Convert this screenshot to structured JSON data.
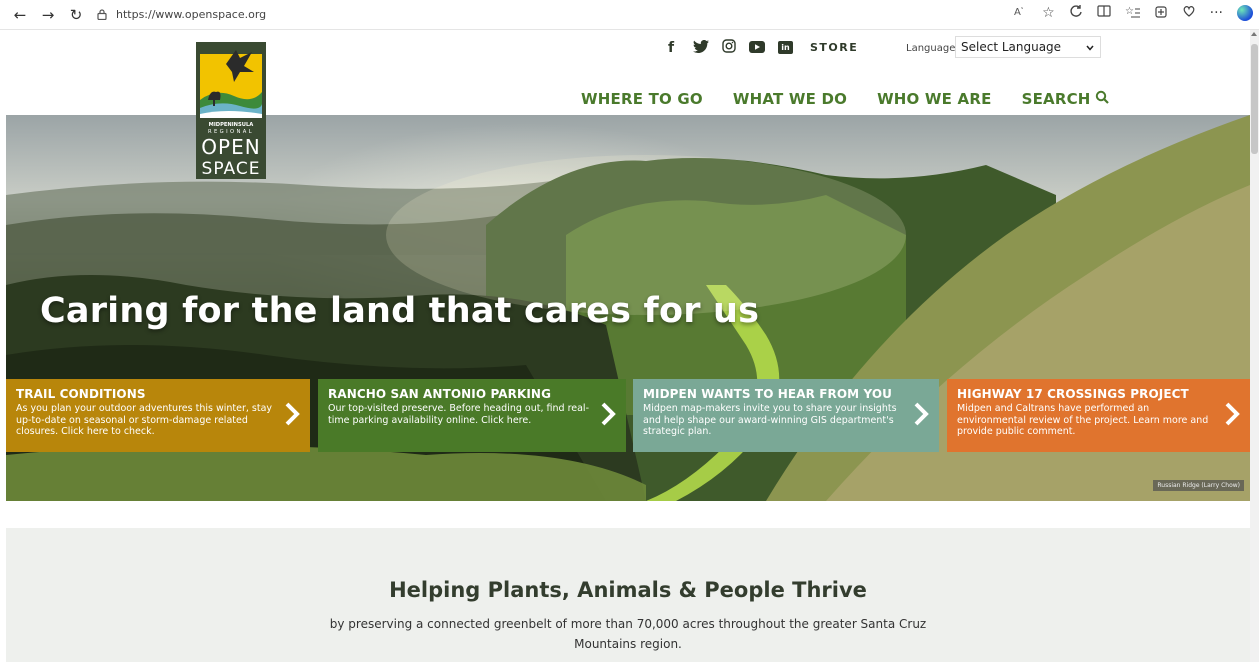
{
  "browser": {
    "url": "https://www.openspace.org",
    "back_icon": "←",
    "forward_icon": "→",
    "refresh_icon": "↻"
  },
  "header": {
    "social": [
      "f",
      "y",
      "ig",
      "yt",
      "in"
    ],
    "store_label": "STORE",
    "language_label": "Language:",
    "language_select": "Select Language",
    "nav": {
      "where": "WHERE TO GO",
      "what": "WHAT WE DO",
      "who": "WHO WE ARE",
      "search": "SEARCH"
    },
    "logo": {
      "line1": "MIDPENINSULA",
      "line2": "REGIONAL",
      "line3": "OPEN",
      "line4": "SPACE"
    }
  },
  "hero": {
    "title": "Caring for the land that cares for us",
    "credit": "Russian Ridge (Larry Chow)",
    "promos": [
      {
        "title": "TRAIL CONDITIONS",
        "text": "As you plan your outdoor adventures this winter, stay up-to-date on seasonal or storm-damage related closures. Click here to check.",
        "color": "#b8860b"
      },
      {
        "title": "RANCHO SAN ANTONIO PARKING",
        "text": "Our top-visited preserve. Before heading out, find real-time parking availability online. Click here.",
        "color": "#4a7a28"
      },
      {
        "title": "MIDPEN WANTS TO HEAR FROM YOU",
        "text": "Midpen map-makers invite you to share your insights and help shape our award-winning GIS department's strategic plan.",
        "color": "#7aa896"
      },
      {
        "title": "HIGHWAY 17 CROSSINGS PROJECT",
        "text": "Midpen and Caltrans have performed an environmental review of the project. Learn more and provide public comment.",
        "color": "#e0742e"
      }
    ]
  },
  "intro": {
    "heading": "Helping Plants, Animals & People Thrive",
    "text": "by preserving a connected greenbelt of more than 70,000 acres throughout the greater Santa Cruz Mountains region."
  },
  "colors": {
    "nav_green": "#4a7a2c",
    "logo_bg": "#3a4a32",
    "logo_yellow": "#f2c300"
  }
}
